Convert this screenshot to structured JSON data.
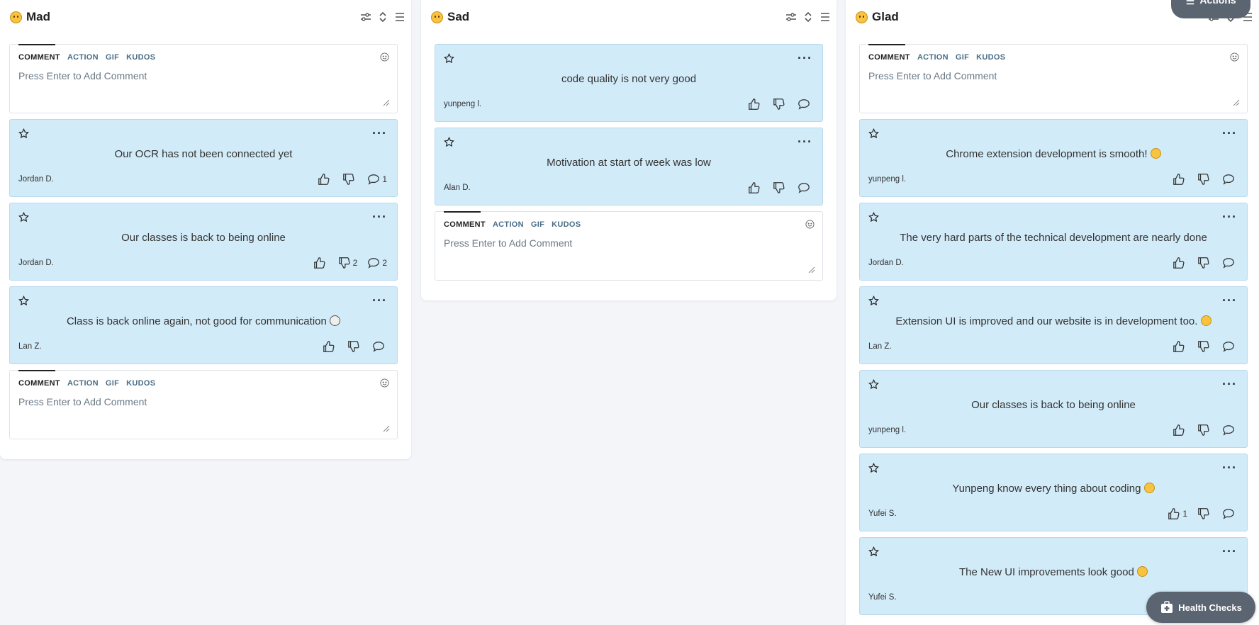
{
  "composer": {
    "tabs": [
      "COMMENT",
      "ACTION",
      "GIF",
      "KUDOS"
    ],
    "placeholder": "Press Enter to Add Comment"
  },
  "columns": [
    {
      "title": "Mad",
      "cards": [
        {
          "text": "Our OCR has not been connected yet",
          "author": "Jordan D.",
          "likes": "",
          "dislikes": "",
          "comments": "1"
        },
        {
          "text": "Our classes is back to being online",
          "author": "Jordan D.",
          "likes": "",
          "dislikes": "2",
          "comments": "2"
        },
        {
          "text": "Class is back online again, not good for communication",
          "author": "Lan Z.",
          "likes": "",
          "dislikes": "",
          "comments": ""
        }
      ]
    },
    {
      "title": "Sad",
      "cards": [
        {
          "text": "code quality is not very good",
          "author": "yunpeng l.",
          "likes": "",
          "dislikes": "",
          "comments": ""
        },
        {
          "text": "Motivation at start of week was low",
          "author": "Alan D.",
          "likes": "",
          "dislikes": "",
          "comments": ""
        }
      ]
    },
    {
      "title": "Glad",
      "cards": [
        {
          "text": "Chrome extension development is smooth!",
          "author": "yunpeng l.",
          "likes": "",
          "dislikes": "",
          "comments": ""
        },
        {
          "text": "The very hard parts of the technical development are nearly done",
          "author": "Jordan D.",
          "likes": "",
          "dislikes": "",
          "comments": ""
        },
        {
          "text": "Extension UI is improved and our website is in development too.",
          "author": "Lan Z.",
          "likes": "",
          "dislikes": "",
          "comments": ""
        },
        {
          "text": "Our classes is back to being online",
          "author": "yunpeng l.",
          "likes": "",
          "dislikes": "",
          "comments": ""
        },
        {
          "text": "Yunpeng know every thing about coding",
          "author": "Yufei S.",
          "likes": "1",
          "dislikes": "",
          "comments": ""
        },
        {
          "text": "The New UI improvements look good",
          "author": "Yufei S.",
          "likes": "",
          "dislikes": "",
          "comments": ""
        }
      ]
    }
  ],
  "buttons": {
    "actions": "Actions",
    "health_checks": "Health Checks"
  },
  "colors": {
    "card_bg": "#d2ebf8",
    "button_bg": "#5b6571",
    "emoji_yellow": "#f8c440"
  }
}
